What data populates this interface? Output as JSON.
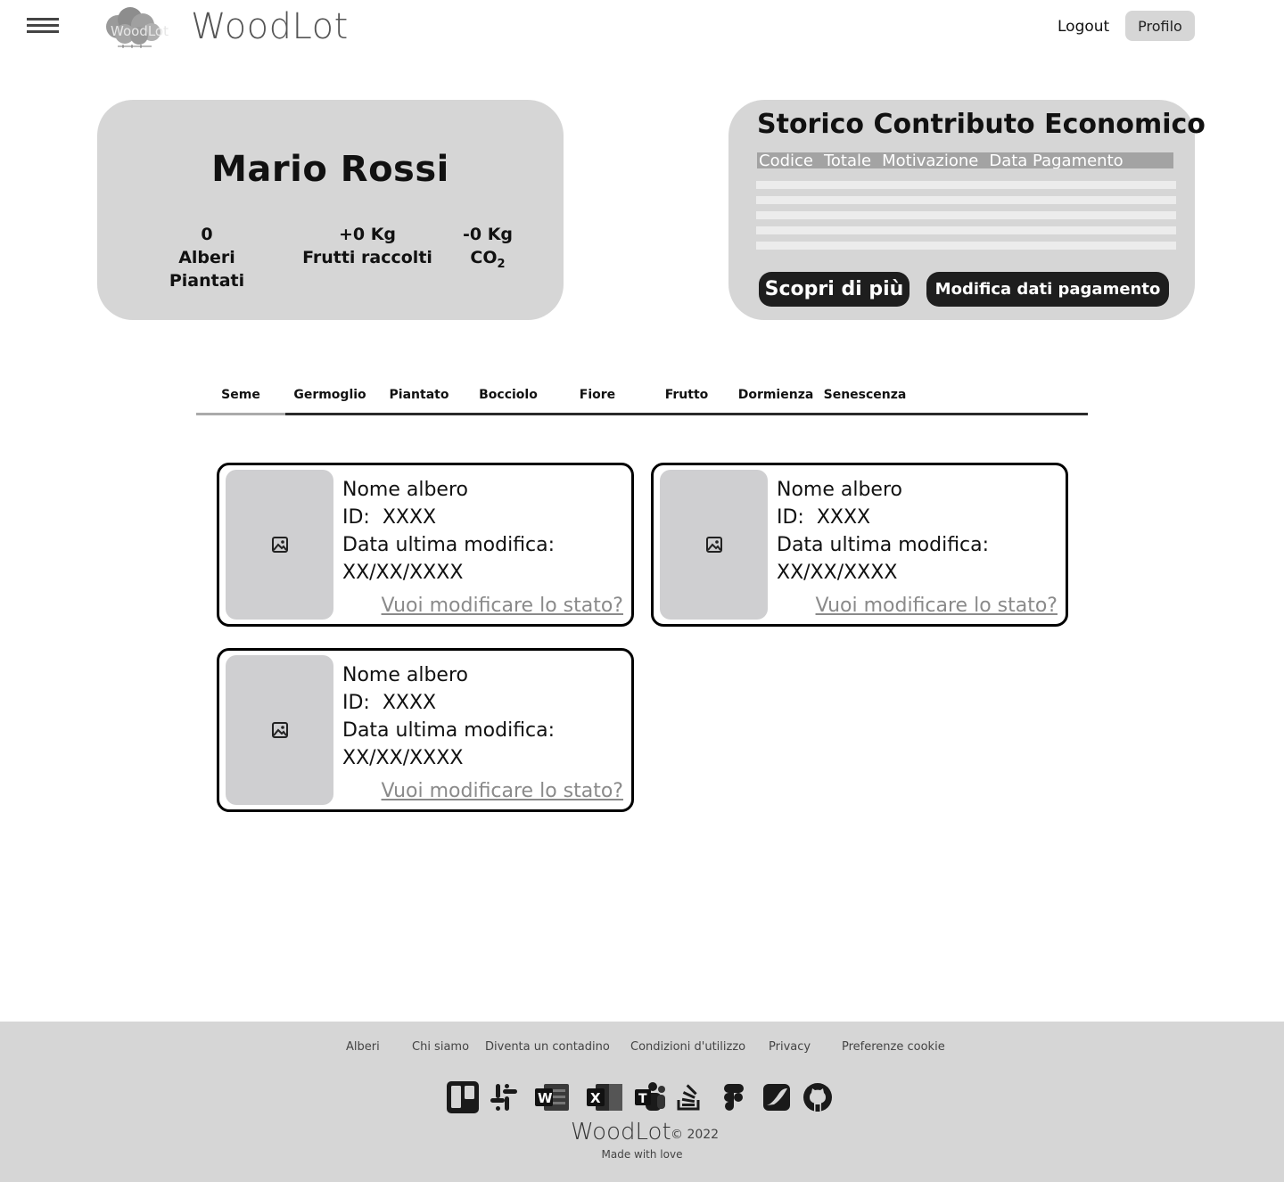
{
  "header": {
    "logo_mark_text": "WoodLot",
    "brand": "WoodLot",
    "logout_label": "Logout",
    "profile_label": "Profilo"
  },
  "profile": {
    "name": "Mario Rossi",
    "stats": [
      {
        "value": "0",
        "label": "Alberi Piantati"
      },
      {
        "value": "+0 Kg",
        "label": "Frutti raccolti"
      },
      {
        "value": "-0 Kg",
        "label": "CO",
        "label_sub": "2"
      }
    ]
  },
  "storico": {
    "title": "Storico Contributo Economico",
    "columns": [
      "Codice",
      "Totale",
      "Motivazione",
      "Data Pagamento"
    ],
    "row_count_visual": 5,
    "button_more": "Scopri di più",
    "button_edit": "Modifica dati pagamento"
  },
  "tabs": {
    "active": "Seme",
    "items": [
      "Seme",
      "Germoglio",
      "Piantato",
      "Bocciolo",
      "Fiore",
      "Frutto",
      "Dormienza",
      "Senescenza"
    ]
  },
  "trees": [
    {
      "name": "Nome albero",
      "id_label": "ID:",
      "id_value": "XXXX",
      "date_label": "Data ultima modifica:",
      "date_value": "XX/XX/XXXX",
      "link": "Vuoi modificare lo stato?"
    },
    {
      "name": "Nome albero",
      "id_label": "ID:",
      "id_value": "XXXX",
      "date_label": "Data ultima modifica:",
      "date_value": "XX/XX/XXXX",
      "link": "Vuoi modificare lo stato?"
    },
    {
      "name": "Nome albero",
      "id_label": "ID:",
      "id_value": "XXXX",
      "date_label": "Data ultima modifica:",
      "date_value": "XX/XX/XXXX",
      "link": "Vuoi modificare lo stato?"
    }
  ],
  "footer": {
    "links": [
      "Alberi",
      "Chi siamo",
      "Diventa un contadino",
      "Condizioni d'utilizzo",
      "Privacy",
      "Preferenze cookie"
    ],
    "icons": [
      "trello-icon",
      "slack-icon",
      "word-icon",
      "excel-icon",
      "teams-icon",
      "stackoverflow-icon",
      "figma-icon",
      "affinity-icon",
      "github-icon"
    ],
    "brand": "WoodLot",
    "copyright": "© 2022",
    "tagline": "Made with love"
  }
}
